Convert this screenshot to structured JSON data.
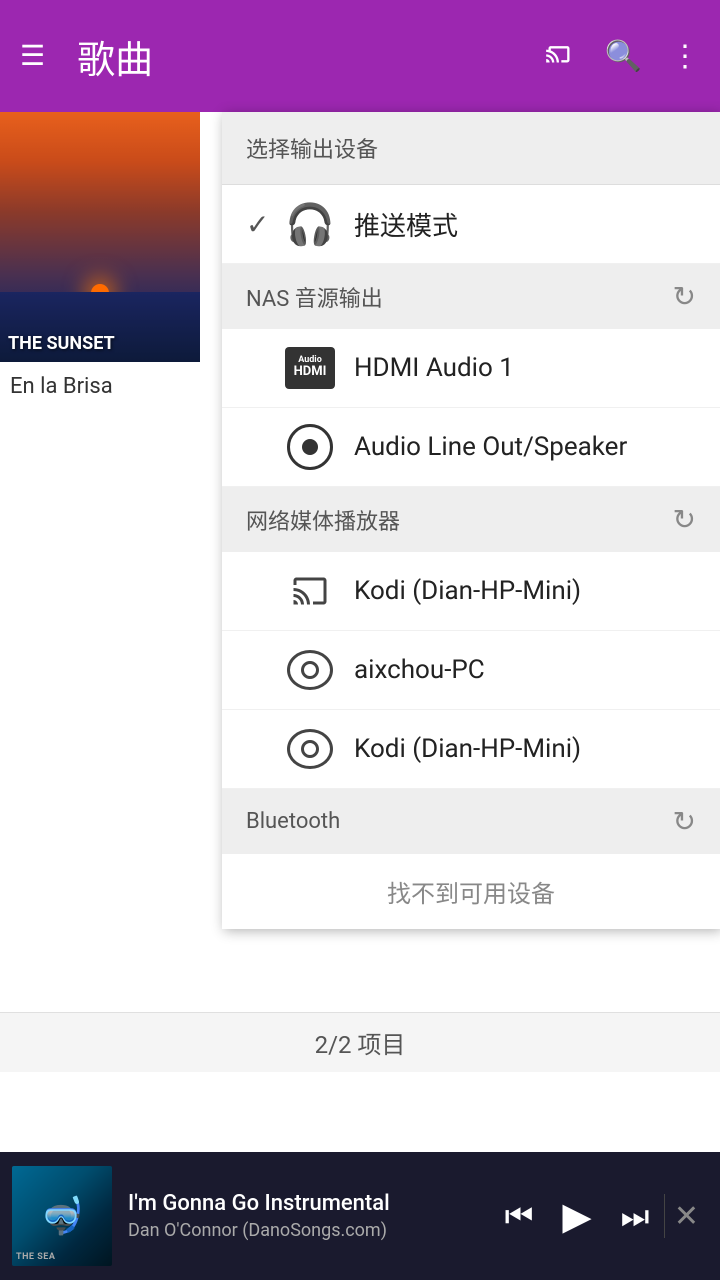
{
  "header": {
    "menu_label": "☰",
    "title": "歌曲",
    "cast_label": "cast",
    "search_label": "search",
    "more_label": "more"
  },
  "dropdown": {
    "title": "选择输出设备",
    "push_mode": {
      "label": "推送模式",
      "selected": true
    },
    "nas_section": {
      "title": "NAS 音源输出",
      "devices": [
        {
          "id": "hdmi1",
          "label": "HDMI Audio 1",
          "icon_type": "hdmi"
        },
        {
          "id": "line_out",
          "label": "Audio Line Out/Speaker",
          "icon_type": "speaker"
        }
      ]
    },
    "media_player_section": {
      "title": "网络媒体播放器",
      "devices": [
        {
          "id": "kodi1",
          "label": "Kodi (Dian-HP-Mini)",
          "icon_type": "cast"
        },
        {
          "id": "aixchou",
          "label": "aixchou-PC",
          "icon_type": "kodi"
        },
        {
          "id": "kodi2",
          "label": "Kodi (Dian-HP-Mini)",
          "icon_type": "kodi"
        }
      ]
    },
    "bluetooth_section": {
      "title": "Bluetooth",
      "no_device_message": "找不到可用设备"
    }
  },
  "song_list": {
    "count_label": "2/2 项目",
    "items": [
      {
        "id": "sunset",
        "title": "En la Brisa",
        "image_label": "THE SUNSET"
      }
    ]
  },
  "player": {
    "song_title": "I'm Gonna Go Instrumental",
    "artist": "Dan O'Connor (DanoSongs.com)",
    "album_art_label": "THE SEA"
  }
}
